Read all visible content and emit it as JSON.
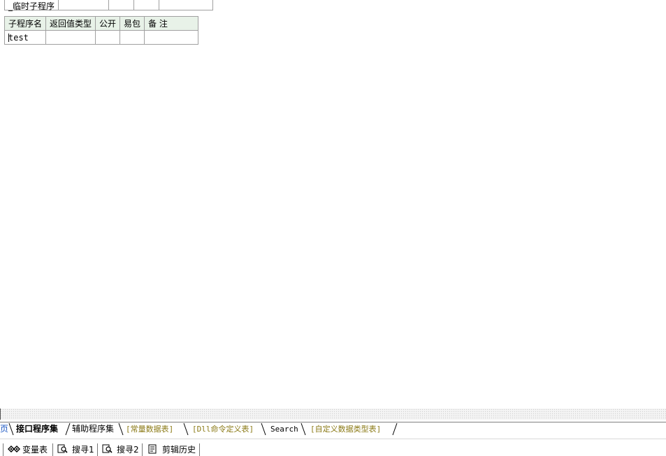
{
  "editor": {
    "top_table": {
      "name": "_临时子程序"
    },
    "sub_table": {
      "headers": [
        "子程序名",
        "返回值类型",
        "公开",
        "易包",
        "备 注"
      ],
      "row": {
        "name": "test",
        "return_type": "",
        "public": "",
        "easy_pkg": "",
        "remark": ""
      }
    }
  },
  "tabs": {
    "partial_first": "页",
    "items": [
      {
        "label": "接口程序集"
      },
      {
        "label": "辅助程序集"
      },
      {
        "label": "[常量数据表]"
      },
      {
        "label": "[Dll命令定义表]"
      },
      {
        "label": "Search"
      },
      {
        "label": "[自定义数据类型表]"
      }
    ]
  },
  "toolbar": {
    "vars": "变量表",
    "search1": "搜寻1",
    "search2": "搜寻2",
    "clip_history": "剪辑历史"
  },
  "colors": {
    "header_bg": "#e8f2e8",
    "gold_tab": "#8b7a16",
    "border": "#a0a0a0"
  }
}
